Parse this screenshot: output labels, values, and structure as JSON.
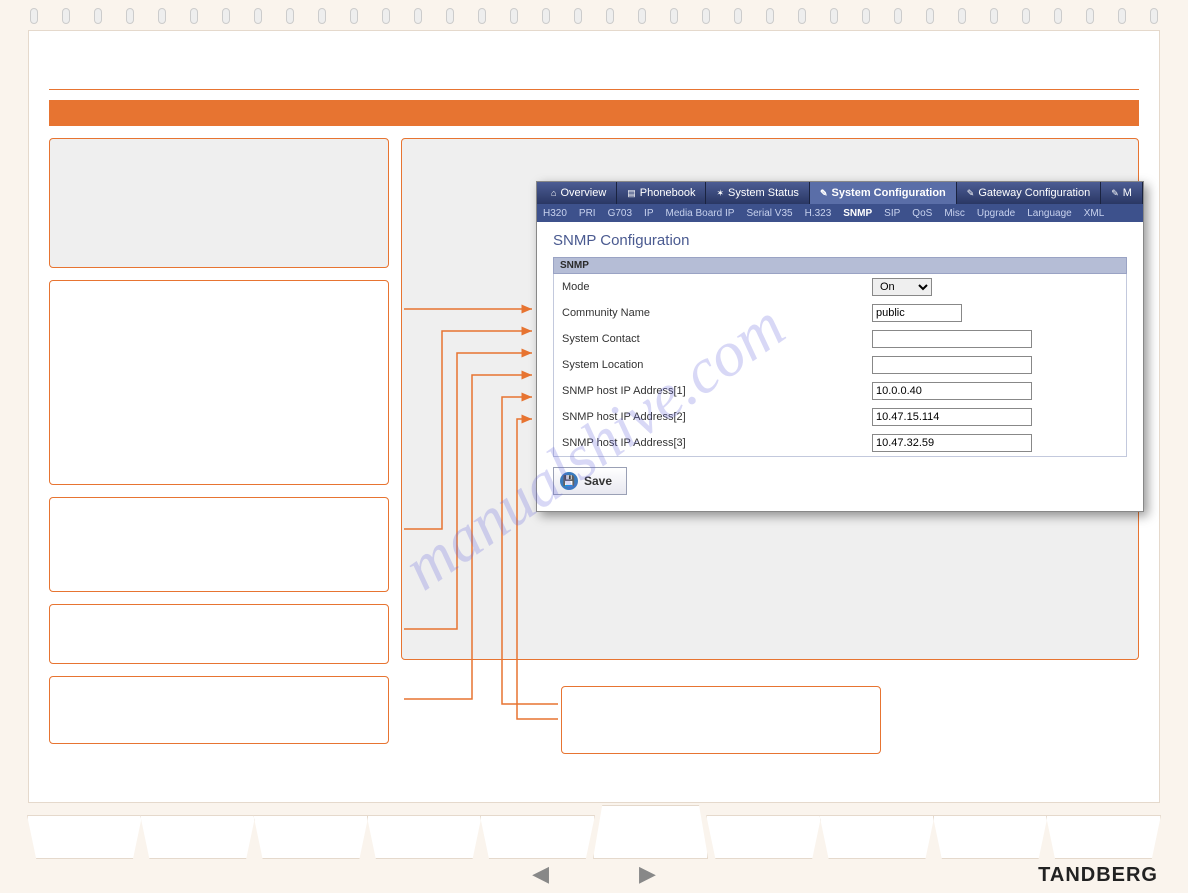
{
  "watermark": "manualshive.com",
  "brand": "TANDBERG",
  "screenshot": {
    "tabs": [
      {
        "label": "Overview",
        "icon": "⌂"
      },
      {
        "label": "Phonebook",
        "icon": "▤"
      },
      {
        "label": "System Status",
        "icon": "✶"
      },
      {
        "label": "System Configuration",
        "icon": "✎",
        "active": true
      },
      {
        "label": "Gateway Configuration",
        "icon": "✎"
      },
      {
        "label": "M",
        "icon": "✎"
      }
    ],
    "subtabs": [
      {
        "label": "H320"
      },
      {
        "label": "PRI"
      },
      {
        "label": "G703"
      },
      {
        "label": "IP"
      },
      {
        "label": "Media Board IP"
      },
      {
        "label": "Serial V35"
      },
      {
        "label": "H.323"
      },
      {
        "label": "SNMP",
        "active": true
      },
      {
        "label": "SIP"
      },
      {
        "label": "QoS"
      },
      {
        "label": "Misc"
      },
      {
        "label": "Upgrade"
      },
      {
        "label": "Language"
      },
      {
        "label": "XML"
      }
    ],
    "title": "SNMP Configuration",
    "section": "SNMP",
    "rows": {
      "mode": {
        "label": "Mode",
        "value": "On"
      },
      "community": {
        "label": "Community Name",
        "value": "public"
      },
      "contact": {
        "label": "System Contact",
        "value": ""
      },
      "location": {
        "label": "System Location",
        "value": ""
      },
      "host1": {
        "label": "SNMP host IP Address[1]",
        "value": "10.0.0.40"
      },
      "host2": {
        "label": "SNMP host IP Address[2]",
        "value": "10.47.15.114"
      },
      "host3": {
        "label": "SNMP host IP Address[3]",
        "value": "10.47.32.59"
      }
    },
    "save": "Save"
  }
}
